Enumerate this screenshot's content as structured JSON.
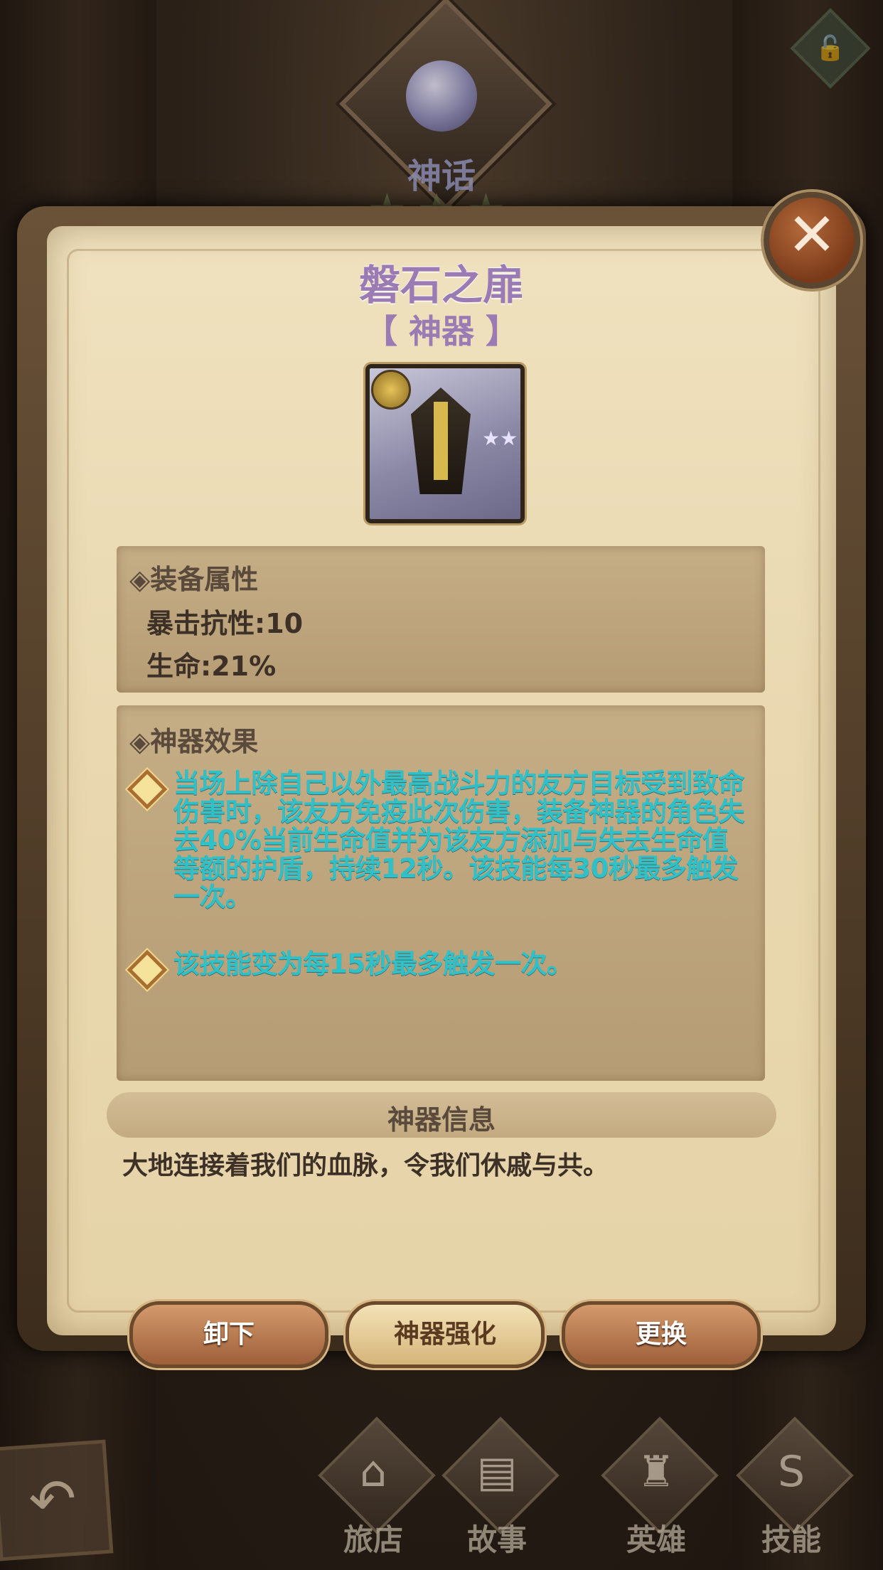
{
  "rarity": {
    "label": "神话",
    "stars": "★★★",
    "gem": "gem-icon"
  },
  "lock": {
    "icon": "lock-icon",
    "glyph": "🔓"
  },
  "close": {
    "glyph": "✕"
  },
  "artifact": {
    "name": "磐石之扉",
    "type": "【 神器 】",
    "icon_stars": "★★"
  },
  "attributes": {
    "header": "◈装备属性",
    "stats": [
      "暴击抗性:10",
      "生命:21%"
    ]
  },
  "effects": {
    "header": "◈神器效果",
    "items": [
      "当场上除自己以外最高战斗力的友方目标受到致命伤害时，该友方免疫此次伤害，装备神器的角色失去40%当前生命值并为该友方添加与失去生命值等额的护盾，持续12秒。该技能每30秒最多触发一次。",
      "该技能变为每15秒最多触发一次。"
    ]
  },
  "info": {
    "header": "神器信息",
    "text": "大地连接着我们的血脉，令我们休戚与共。"
  },
  "buttons": {
    "unequip": "卸下",
    "enhance": "神器强化",
    "replace": "更换"
  },
  "nav": {
    "back_glyph": "↶",
    "items": [
      {
        "label": "旅店",
        "icon": "inn-icon",
        "glyph": "⌂"
      },
      {
        "label": "故事",
        "icon": "book-icon",
        "glyph": "▤"
      },
      {
        "label": "英雄",
        "icon": "hero-icon",
        "glyph": "♜"
      },
      {
        "label": "技能",
        "icon": "skill-icon",
        "glyph": "S"
      }
    ]
  }
}
